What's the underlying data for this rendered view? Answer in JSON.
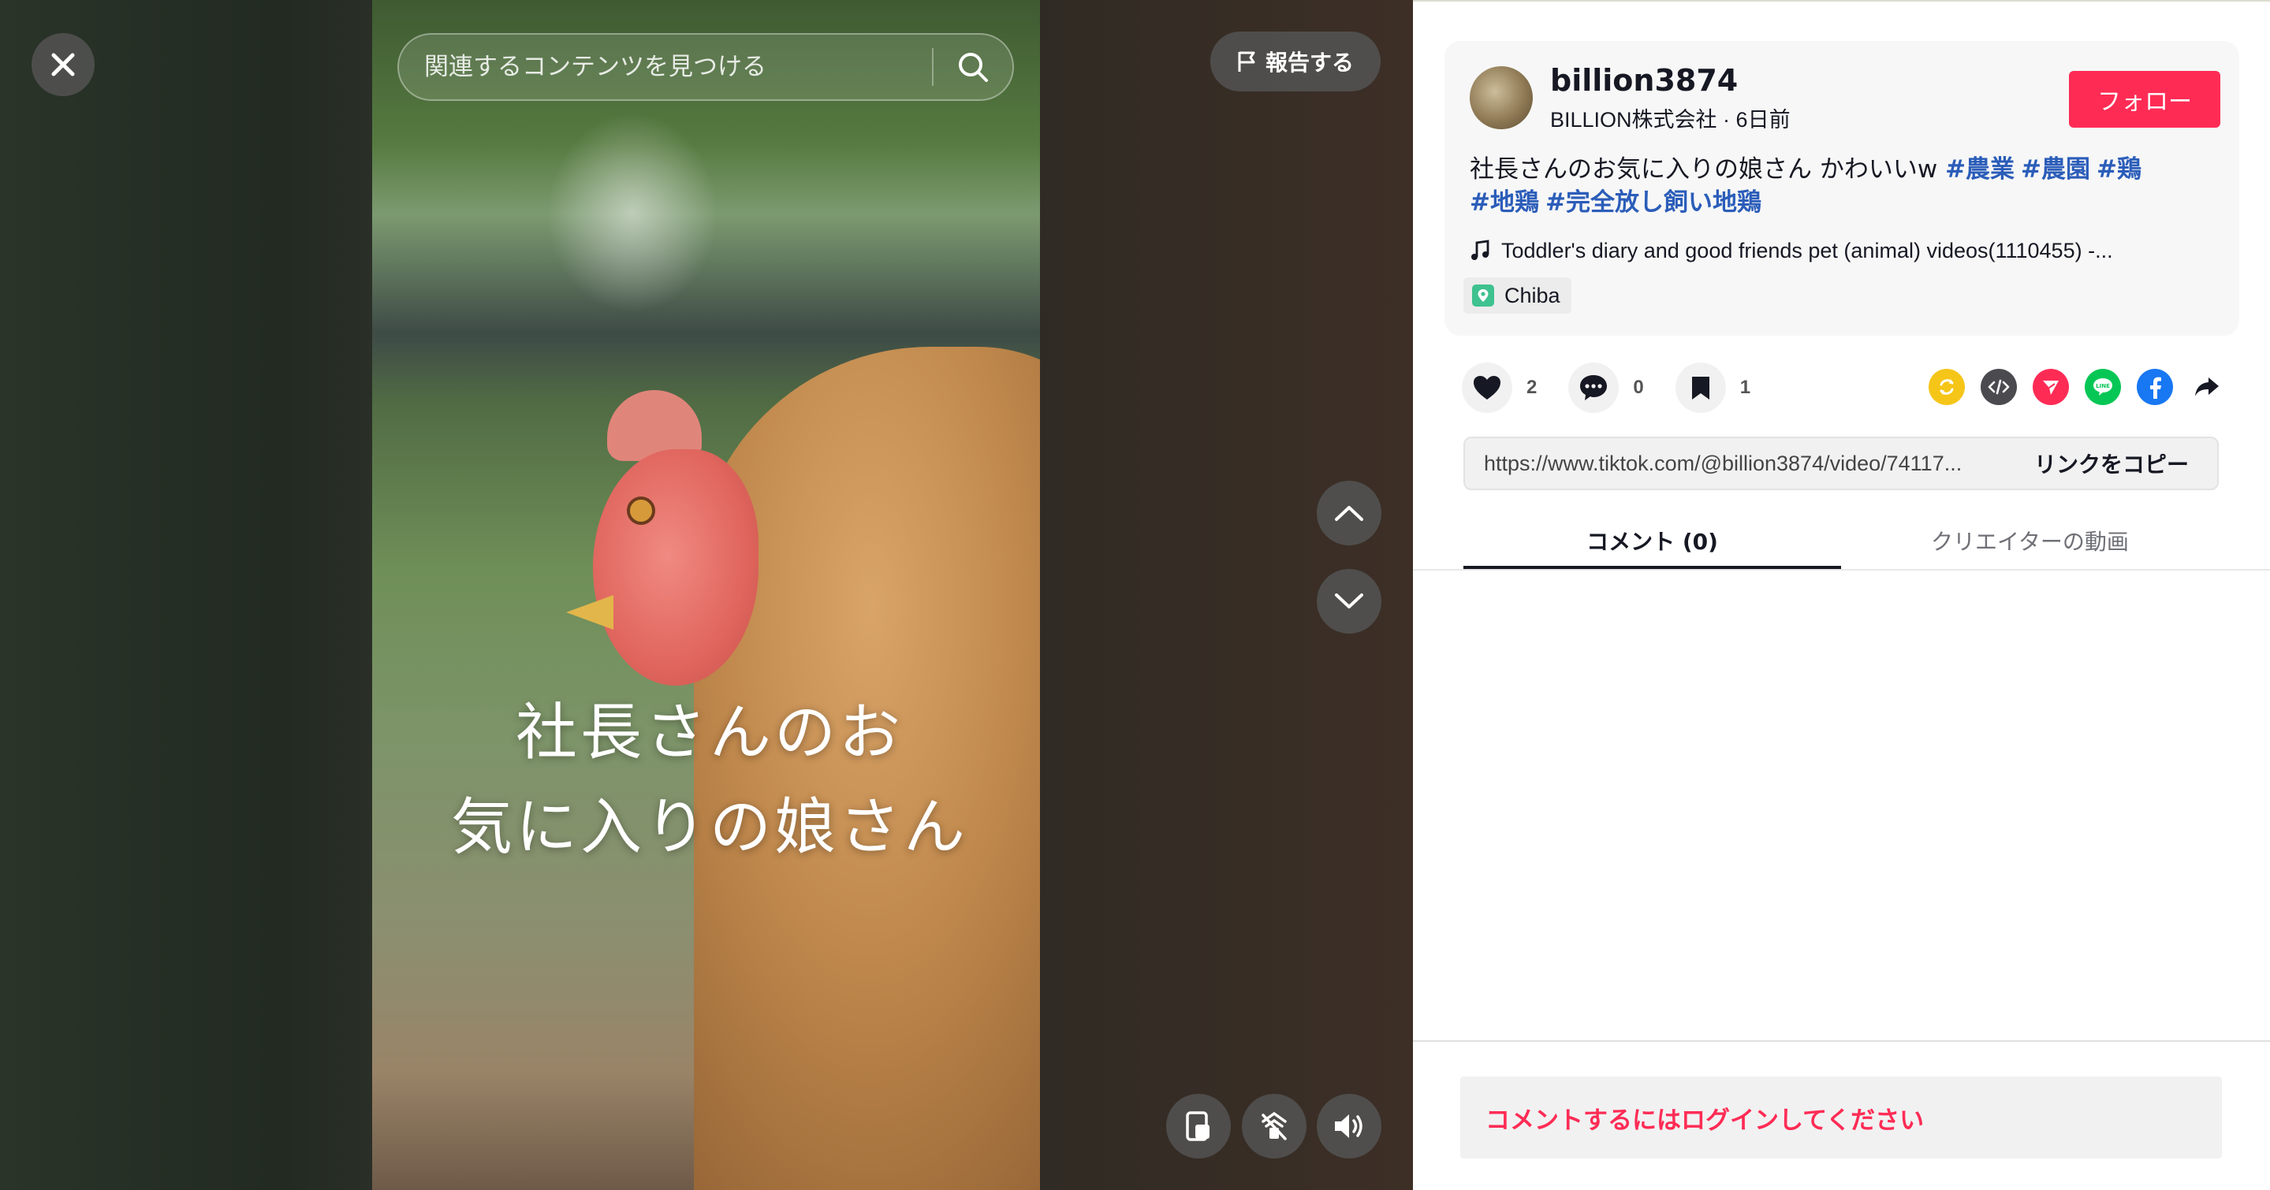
{
  "video": {
    "caption_line1": "社長さんのお",
    "caption_line2": "気に入りの娘さん"
  },
  "search": {
    "placeholder": "関連するコンテンツを見つける"
  },
  "report": {
    "label": "報告する"
  },
  "author": {
    "username": "billion3874",
    "display_name": "BILLION株式会社",
    "separator": " · ",
    "posted_ago": "6日前",
    "follow_label": "フォロー"
  },
  "post": {
    "text": "社長さんのお気に入りの娘さん かわいいw ",
    "hashtags": [
      "#農業",
      "#農園",
      "#鶏",
      "#地鶏",
      "#完全放し飼い地鶏"
    ],
    "music": "Toddler's diary and good friends pet (animal) videos(1110455) -...",
    "location": "Chiba"
  },
  "stats": {
    "likes": "2",
    "comments": "0",
    "saves": "1"
  },
  "share": {
    "icons": [
      "repost-icon",
      "embed-icon",
      "send-icon",
      "line-icon",
      "facebook-icon",
      "share-arrow-icon"
    ],
    "colors": {
      "repost": "#f5c518",
      "embed": "#4a4a4f",
      "send": "#fe2c55",
      "line": "#06c755",
      "facebook": "#1877f2"
    }
  },
  "link": {
    "url": "https://www.tiktok.com/@billion3874/video/74117...",
    "copy_label": "リンクをコピー"
  },
  "tabs": {
    "comments": "コメント (0)",
    "creator_videos": "クリエイターの動画"
  },
  "login_prompt": "コメントするにはログインしてください",
  "theme": {
    "accent": "#fe2c55",
    "hashtag": "#2b5db9",
    "text": "#161823"
  }
}
